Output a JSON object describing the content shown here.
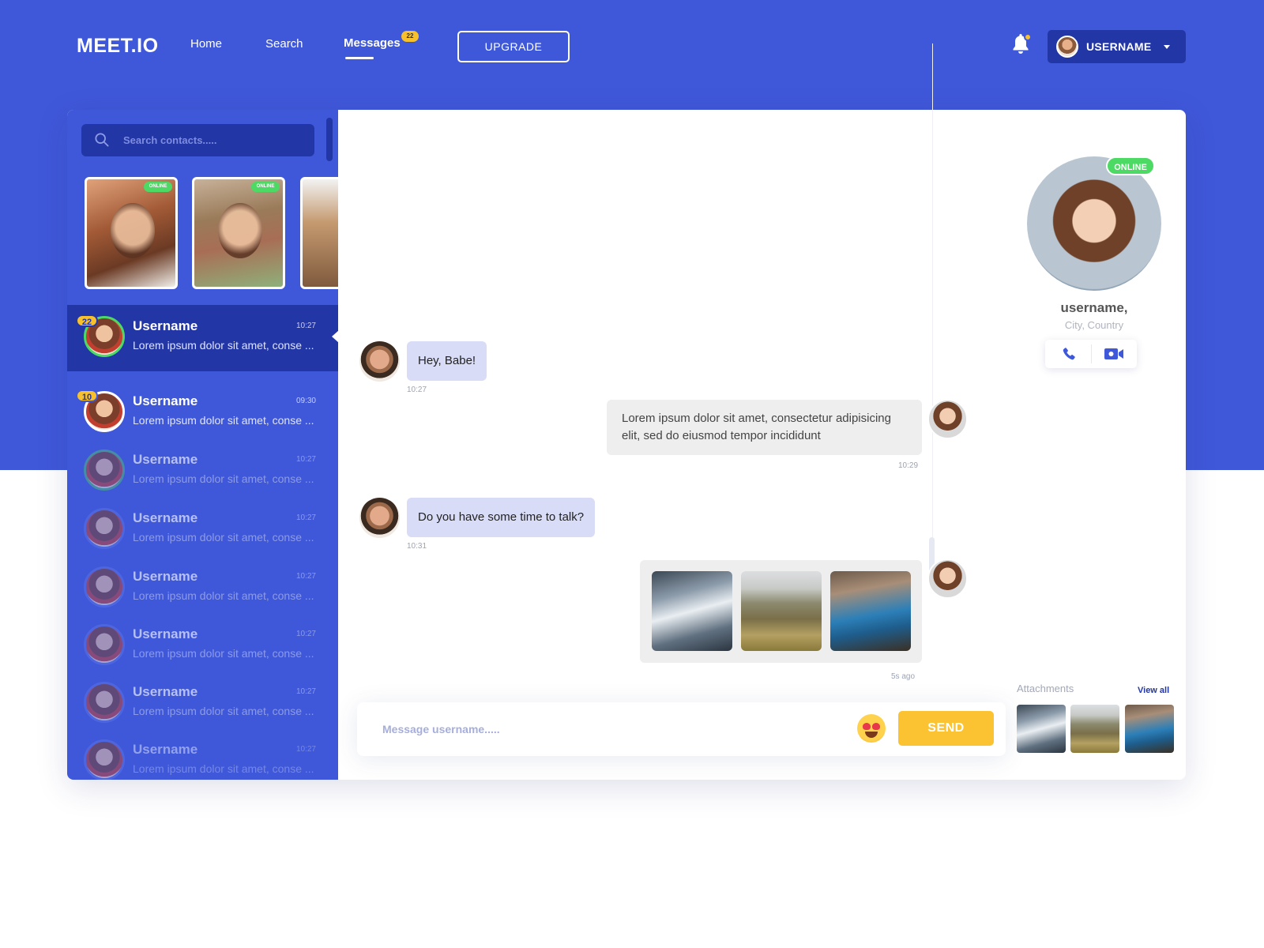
{
  "header": {
    "logo": "MEET.IO",
    "nav": {
      "home": "Home",
      "search": "Search",
      "messages": "Messages",
      "messages_badge": "22"
    },
    "upgrade_label": "UPGRADE",
    "user_label": "USERNAME"
  },
  "sidebar": {
    "search_placeholder": "Search contacts.....",
    "stories": [
      {
        "status": "ONLINE"
      },
      {
        "status": "ONLINE"
      },
      {
        "status": ""
      }
    ],
    "contacts": [
      {
        "name": "Username",
        "time": "10:27",
        "preview": "Lorem ipsum dolor sit amet, conse ...",
        "badge": "22"
      },
      {
        "name": "Username",
        "time": "09:30",
        "preview": "Lorem ipsum dolor sit amet, conse ...",
        "badge": "10"
      },
      {
        "name": "Username",
        "time": "10:27",
        "preview": "Lorem ipsum dolor sit amet, conse ..."
      },
      {
        "name": "Username",
        "time": "10:27",
        "preview": "Lorem ipsum dolor sit amet, conse ..."
      },
      {
        "name": "Username",
        "time": "10:27",
        "preview": "Lorem ipsum dolor sit amet, conse ..."
      },
      {
        "name": "Username",
        "time": "10:27",
        "preview": "Lorem ipsum dolor sit amet, conse ..."
      },
      {
        "name": "Username",
        "time": "10:27",
        "preview": "Lorem ipsum dolor sit amet, conse ..."
      },
      {
        "name": "Username",
        "time": "10:27",
        "preview": "Lorem ipsum dolor sit amet, conse ..."
      }
    ]
  },
  "chat": {
    "messages": [
      {
        "text": "Hey, Babe!",
        "time": "10:27"
      },
      {
        "text": "Lorem ipsum dolor sit amet, consectetur adipisicing elit, sed do eiusmod tempor incididunt",
        "time": "10:29"
      },
      {
        "text": "Do you have some time to talk?",
        "time": "10:31"
      },
      {
        "time": "5s ago"
      }
    ],
    "composer_placeholder": "Message username.....",
    "send_label": "SEND"
  },
  "profile": {
    "status": "ONLINE",
    "name": "username,",
    "location": "City, Country",
    "attachments_label": "Attachments",
    "view_all_label": "View all"
  },
  "icons": {
    "search": "search-icon",
    "bell": "bell-icon",
    "caret": "caret-down-icon",
    "phone": "phone-icon",
    "video": "video-camera-icon",
    "emoji": "heart-eyes-emoji-icon"
  },
  "colors": {
    "primary": "#3f58d9",
    "primary_dark": "#2336a5",
    "accent": "#fbc331",
    "online": "#4cd964",
    "bubble_in": "#d9dcf7",
    "bubble_out": "#eeeeee"
  }
}
